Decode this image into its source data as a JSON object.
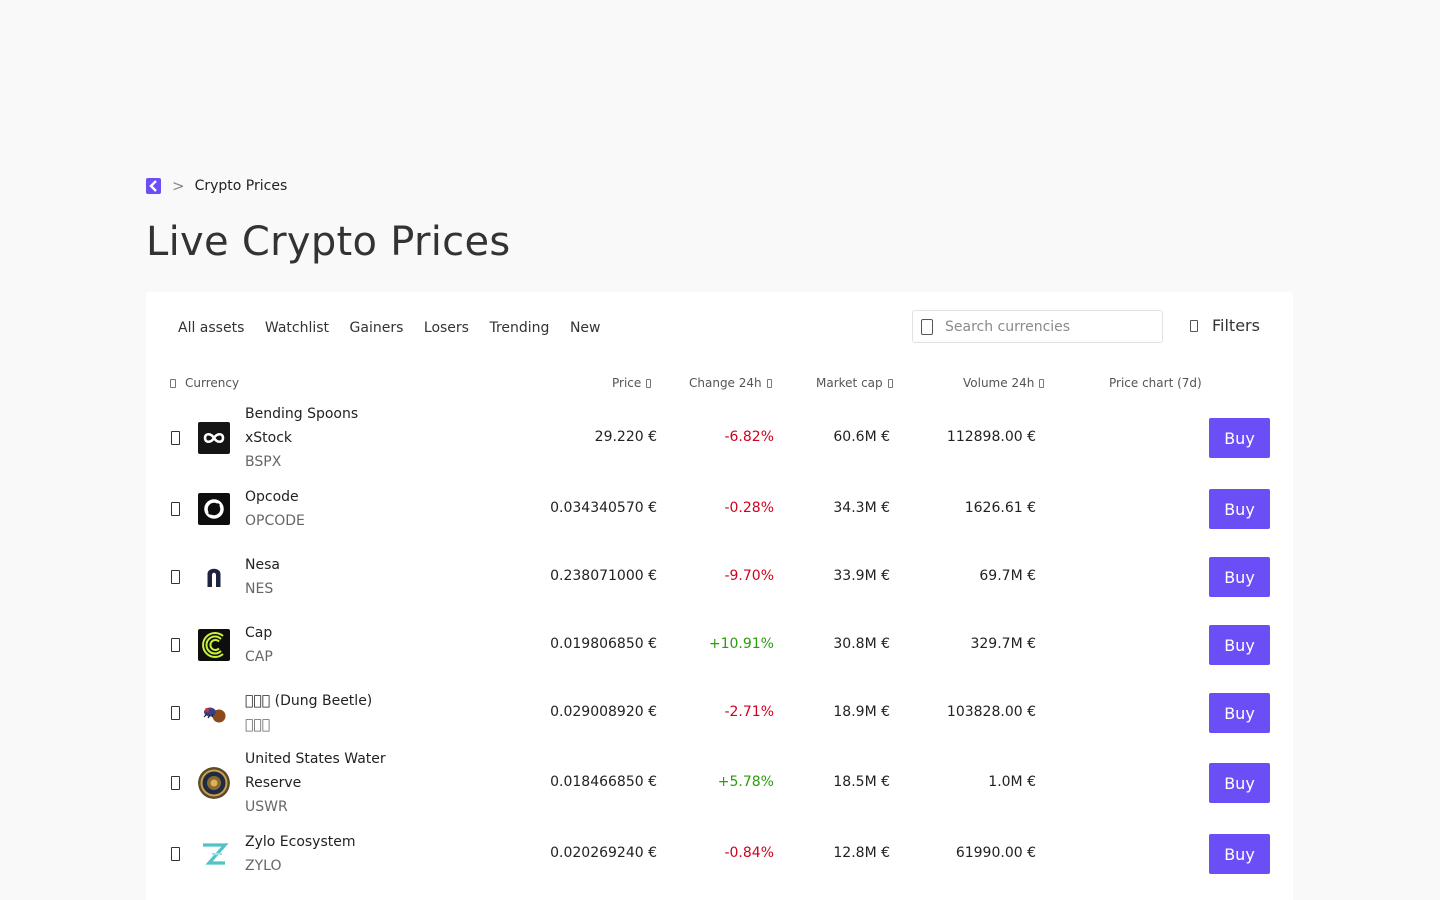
{
  "breadcrumb": {
    "separator": ">",
    "current": "Crypto Prices"
  },
  "page_title": "Live Crypto Prices",
  "tabs": [
    "All assets",
    "Watchlist",
    "Gainers",
    "Losers",
    "Trending",
    "New"
  ],
  "search": {
    "placeholder": "Search currencies",
    "value": ""
  },
  "filters_label": "Filters",
  "columns": {
    "currency": "Currency",
    "price": "Price",
    "change": "Change 24h",
    "market_cap": "Market cap",
    "volume": "Volume 24h",
    "chart": "Price chart (7d)"
  },
  "buy_label": "Buy",
  "rows": [
    {
      "name_line1": "Bending Spoons",
      "name_line2": "xStock",
      "symbol": "BSPX",
      "price": "29.220 €",
      "change": "-6.82%",
      "direction": "down",
      "market_cap": "60.6M €",
      "volume": "112898.00 €",
      "icon": "infinity-icon"
    },
    {
      "name_line1": "Opcode",
      "name_line2": "",
      "symbol": "OPCODE",
      "price": "0.034340570 €",
      "change": "-0.28%",
      "direction": "down",
      "market_cap": "34.3M €",
      "volume": "1626.61 €",
      "icon": "ring-icon"
    },
    {
      "name_line1": "Nesa",
      "name_line2": "",
      "symbol": "NES",
      "price": "0.238071000 €",
      "change": "-9.70%",
      "direction": "down",
      "market_cap": "33.9M €",
      "volume": "69.7M €",
      "icon": "arch-icon"
    },
    {
      "name_line1": "Cap",
      "name_line2": "",
      "symbol": "CAP",
      "price": "0.019806850 €",
      "change": "+10.91%",
      "direction": "up",
      "market_cap": "30.8M €",
      "volume": "329.7M €",
      "icon": "concentric-arcs-icon"
    },
    {
      "name_line1": "\u0000\u0000\u0000 (Dung Beetle)",
      "name_line2": "",
      "symbol": "\u0000\u0000\u0000",
      "price": "0.029008920 €",
      "change": "-2.71%",
      "direction": "down",
      "market_cap": "18.9M €",
      "volume": "103828.00 €",
      "icon": "beetle-icon"
    },
    {
      "name_line1": "United States Water",
      "name_line2": "Reserve",
      "symbol": "USWR",
      "price": "0.018466850 €",
      "change": "+5.78%",
      "direction": "up",
      "market_cap": "18.5M €",
      "volume": "1.0M €",
      "icon": "seal-icon"
    },
    {
      "name_line1": "Zylo Ecosystem",
      "name_line2": "",
      "symbol": "ZYLO",
      "price": "0.020269240 €",
      "change": "-0.84%",
      "direction": "down",
      "market_cap": "12.8M €",
      "volume": "61990.00 €",
      "icon": "z-letter-icon"
    }
  ]
}
